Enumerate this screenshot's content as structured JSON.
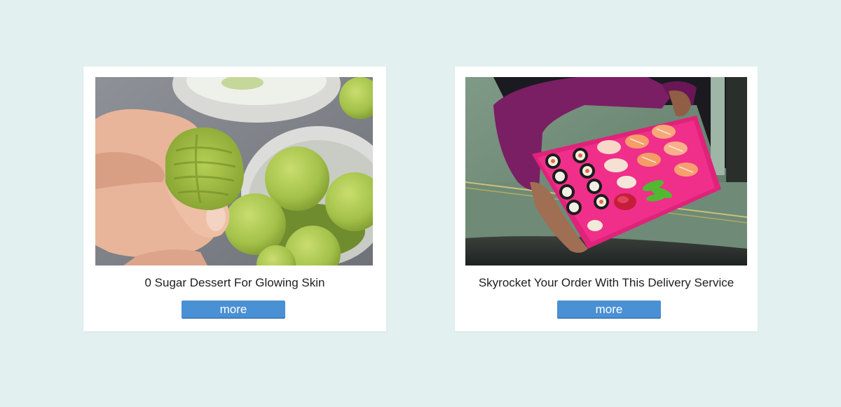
{
  "page": {
    "background_color": "#e2f0f0"
  },
  "cards": [
    {
      "title": "0 Sugar Dessert For Glowing Skin",
      "button_label": "more",
      "image_alt": "hand holding bitten matcha ball"
    },
    {
      "title": "Skyrocket Your Order With This Delivery Service",
      "button_label": "more",
      "image_alt": "pink tray of sushi handed from car window"
    }
  ],
  "colors": {
    "card": "#ffffff",
    "button": "#4a90d4",
    "button_text": "#ffffff",
    "title_text": "#1e1e1e"
  }
}
